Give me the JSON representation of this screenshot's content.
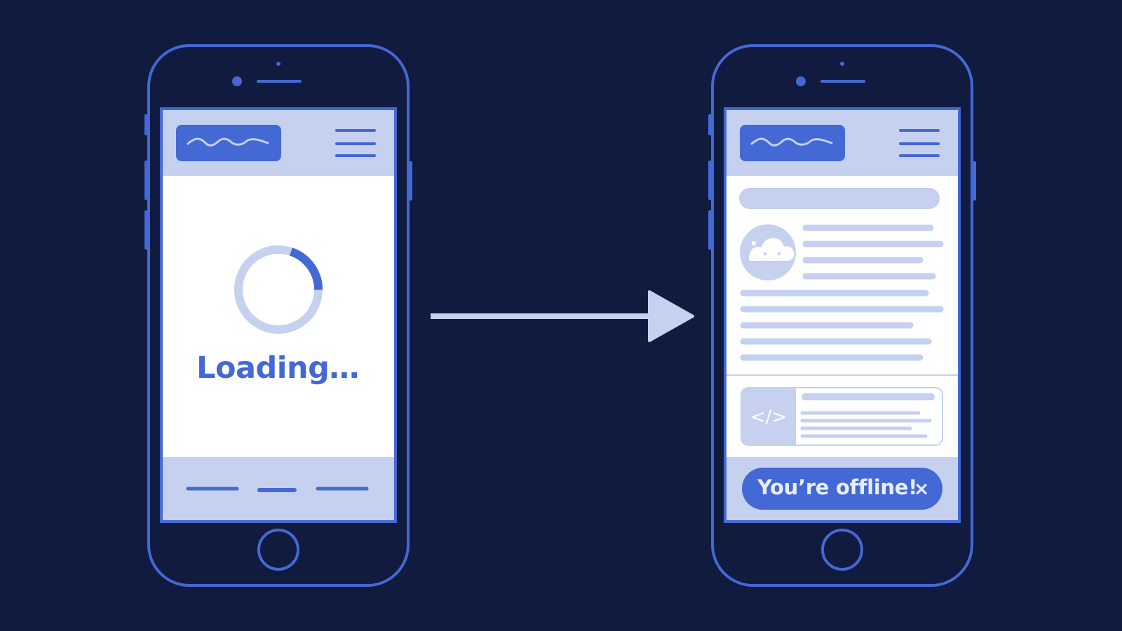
{
  "colors": {
    "background": "#101b3f",
    "phone_outline": "#4468d4",
    "accent": "#4468d4",
    "pale": "#c5d1ef",
    "screen": "#ffffff"
  },
  "loading_phone": {
    "status_text": "Loading…",
    "spinner_progress": 0.2
  },
  "arrow": {
    "direction": "right"
  },
  "loaded_phone": {
    "toast": {
      "message": "You’re offline!",
      "close_glyph": "×"
    },
    "avatar_icon": "cloud-icon",
    "code_icon": "code-brackets-icon",
    "code_glyph": "</>"
  }
}
